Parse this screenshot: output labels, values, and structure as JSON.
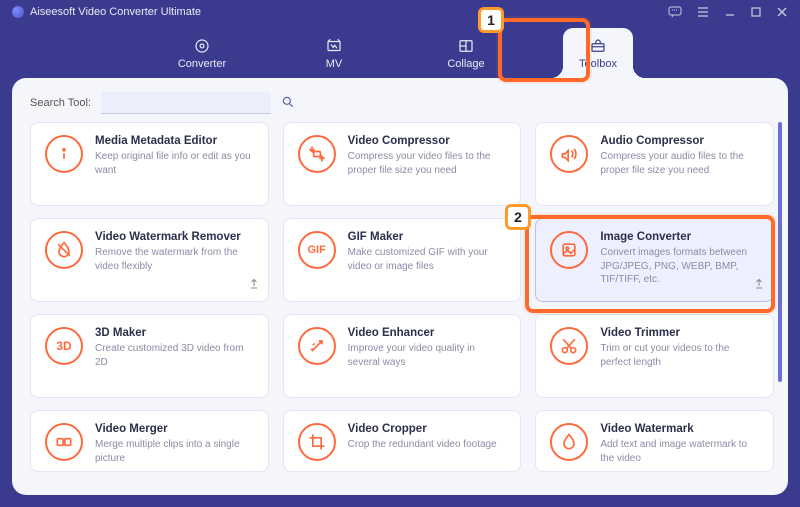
{
  "app": {
    "title": "Aiseesoft Video Converter Ultimate"
  },
  "tabs": [
    {
      "label": "Converter"
    },
    {
      "label": "MV"
    },
    {
      "label": "Collage"
    },
    {
      "label": "Toolbox"
    }
  ],
  "search": {
    "label": "Search Tool:",
    "placeholder": ""
  },
  "tools": [
    {
      "icon": "info-icon",
      "title": "Media Metadata Editor",
      "desc": "Keep original file info or edit as you want"
    },
    {
      "icon": "compress-icon",
      "title": "Video Compressor",
      "desc": "Compress your video files to the proper file size you need"
    },
    {
      "icon": "audio-icon",
      "title": "Audio Compressor",
      "desc": "Compress your audio files to the proper file size you need"
    },
    {
      "icon": "nowater-icon",
      "title": "Video Watermark Remover",
      "desc": "Remove the watermark from the video flexibly"
    },
    {
      "icon": "gif-icon",
      "title": "GIF Maker",
      "desc": "Make customized GIF with your video or image files"
    },
    {
      "icon": "imgconv-icon",
      "title": "Image Converter",
      "desc": "Convert images formats between JPG/JPEG, PNG, WEBP, BMP, TIF/TIFF, etc."
    },
    {
      "icon": "3d-icon",
      "title": "3D Maker",
      "desc": "Create customized 3D video from 2D"
    },
    {
      "icon": "enhance-icon",
      "title": "Video Enhancer",
      "desc": "Improve your video quality in several ways"
    },
    {
      "icon": "trim-icon",
      "title": "Video Trimmer",
      "desc": "Trim or cut your videos to the perfect length"
    },
    {
      "icon": "merge-icon",
      "title": "Video Merger",
      "desc": "Merge multiple clips into a single picture"
    },
    {
      "icon": "crop-icon",
      "title": "Video Cropper",
      "desc": "Crop the redundant video footage"
    },
    {
      "icon": "watermark-icon",
      "title": "Video Watermark",
      "desc": "Add text and image watermark to the video"
    }
  ],
  "annotations": {
    "badge1": "1",
    "badge2": "2"
  },
  "colors": {
    "accent": "#ff6a3d",
    "brand": "#3a3b8f"
  }
}
